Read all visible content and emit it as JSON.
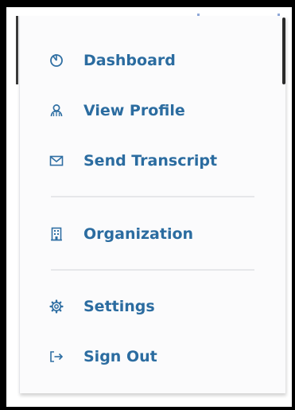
{
  "menu": {
    "items": [
      {
        "id": "dashboard",
        "label": "Dashboard",
        "icon": "dashboard-icon"
      },
      {
        "id": "view-profile",
        "label": "View Profile",
        "icon": "profile-icon"
      },
      {
        "id": "send-transcript",
        "label": "Send Transcript",
        "icon": "envelope-icon"
      },
      {
        "id": "organization",
        "label": "Organization",
        "icon": "building-icon"
      },
      {
        "id": "settings",
        "label": "Settings",
        "icon": "gear-icon"
      },
      {
        "id": "sign-out",
        "label": "Sign Out",
        "icon": "sign-out-icon"
      }
    ]
  },
  "colors": {
    "label": "#2b6ca0",
    "icon": "#2f6fa3",
    "divider": "#e6e7ea",
    "panel": "#fbfbfc"
  }
}
